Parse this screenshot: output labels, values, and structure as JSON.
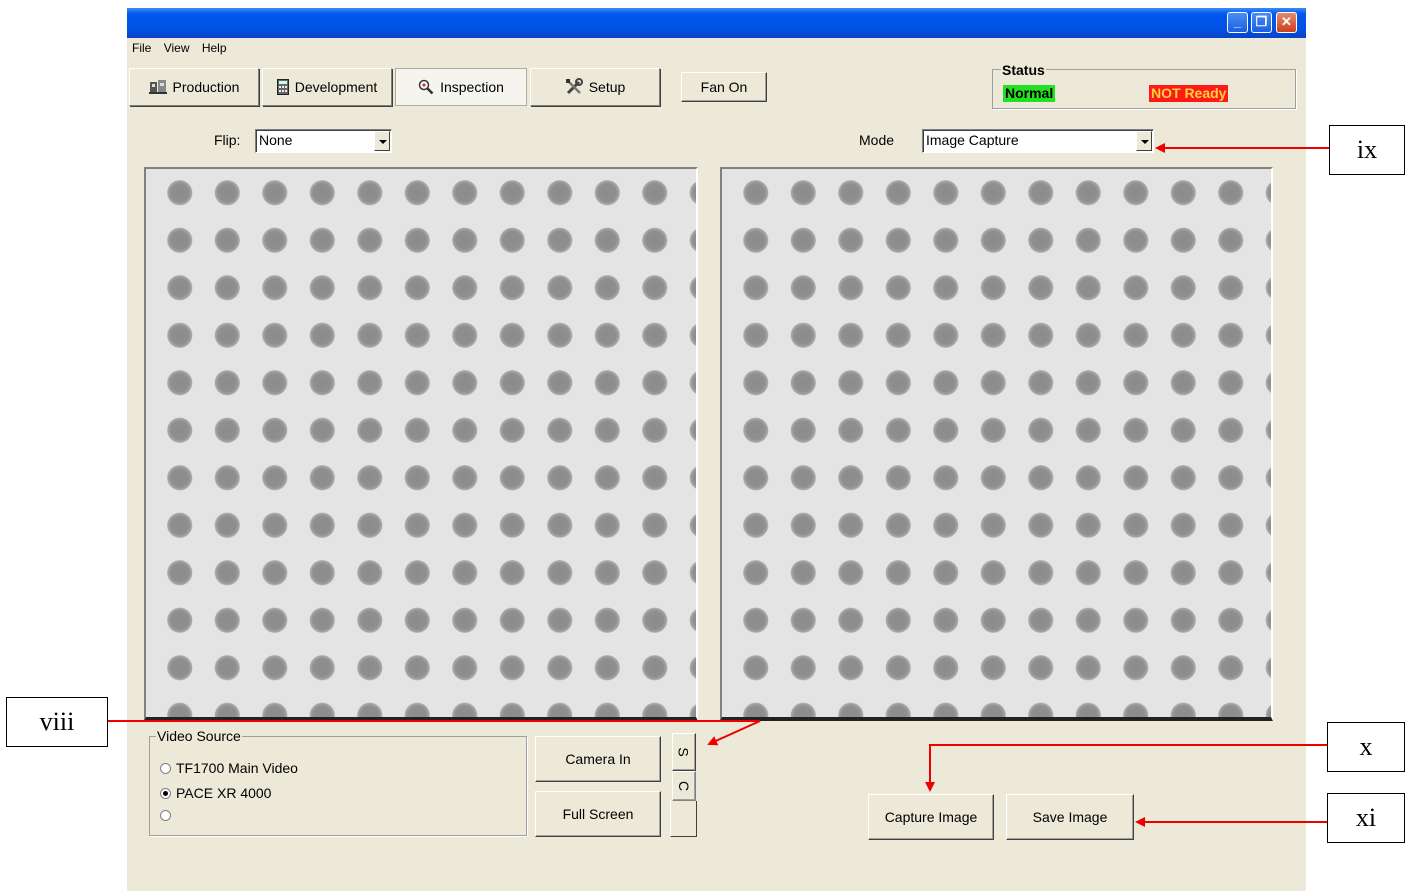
{
  "window": {
    "controls": {
      "minimize": "_",
      "maximize": "❐",
      "close": "✕"
    }
  },
  "menu": [
    "File",
    "View",
    "Help"
  ],
  "toolbar": {
    "production": "Production",
    "development": "Development",
    "inspection": "Inspection",
    "setup": "Setup",
    "fan": "Fan On",
    "active_tab": "Inspection"
  },
  "status": {
    "label": "Status",
    "normal": "Normal",
    "normal_color": "#22e022",
    "not_ready": "NOT Ready",
    "not_ready_color": "#ff1a1a"
  },
  "flip": {
    "label": "Flip:",
    "value": "None"
  },
  "mode": {
    "label": "Mode",
    "value": "Image Capture"
  },
  "video_source": {
    "label": "Video Source",
    "options": [
      {
        "label": "TF1700 Main Video",
        "checked": false
      },
      {
        "label": "PACE XR 4000",
        "checked": true
      },
      {
        "label": "",
        "checked": false
      }
    ]
  },
  "buttons": {
    "camera_in": "Camera In",
    "full_screen": "Full Screen",
    "side_s": "S",
    "side_c": "C",
    "capture_image": "Capture Image",
    "save_image": "Save Image"
  },
  "callouts": {
    "viii": "viii",
    "ix": "ix",
    "x": "x",
    "xi": "xi"
  },
  "accent_colors": {
    "arrow": "#ee0000",
    "titlebar": "#0058ee"
  }
}
